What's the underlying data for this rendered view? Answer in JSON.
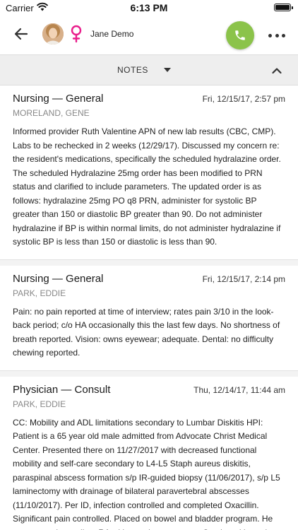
{
  "status_bar": {
    "carrier": "Carrier",
    "time": "6:13 PM"
  },
  "header": {
    "patient_name": "Jane Demo",
    "gender_icon": "female-symbol-icon",
    "accent_gender": "#e91e8c",
    "call_color": "#8bc34a"
  },
  "notes_bar": {
    "label": "NOTES"
  },
  "notes": [
    {
      "title": "Nursing — General",
      "date": "Fri, 12/15/17, 2:57 pm",
      "author": "MORELAND, GENE",
      "body": "Informed provider Ruth Valentine APN of new lab results (CBC, CMP). Labs to be rechecked in 2 weeks (12/29/17). Discussed my concern re: the resident's medications, specifically the scheduled hydralazine order. The scheduled Hydralazine 25mg order has been modified to PRN status and clarified to include parameters. The updated order is as follows: hydralazine 25mg PO q8 PRN, administer for systolic BP greater than 150 or diastolic BP greater than 90. Do not administer hydralazine if BP is within normal limits, do not administer hydralazine if systolic BP is less than 150 or diastolic is less than 90."
    },
    {
      "title": "Nursing — General",
      "date": "Fri, 12/15/17, 2:14 pm",
      "author": "PARK, EDDIE",
      "body": "Pain: no pain reported at time of interview; rates pain 3/10 in the look-back period; c/o HA occasionally this the last few days. No shortness of breath reported. Vision: owns eyewear; adequate. Dental: no difficulty chewing reported."
    },
    {
      "title": "Physician — Consult",
      "date": "Thu, 12/14/17, 11:44 am",
      "author": "PARK, EDDIE",
      "body": "CC: Mobility and ADL limitations secondary to Lumbar Diskitis HPI: Patient is a 65 year old male admitted from Advocate Christ Medical Center. Presented there on 11/27/2017 with decreased functional mobility and self-care secondary to L4-L5 Staph aureus diskitis, paraspinal abscess formation s/p IR-guided biopsy (11/06/2017), s/p L5 laminectomy with drainage of bilateral paravertebral abscesses (11/10/2017). Per ID, infection controlled and completed Oxacillin. Significant pain controlled. Placed on bowel and bladder program. He was saturating well on RA with ongoing treatment. Continued heparin"
    }
  ]
}
